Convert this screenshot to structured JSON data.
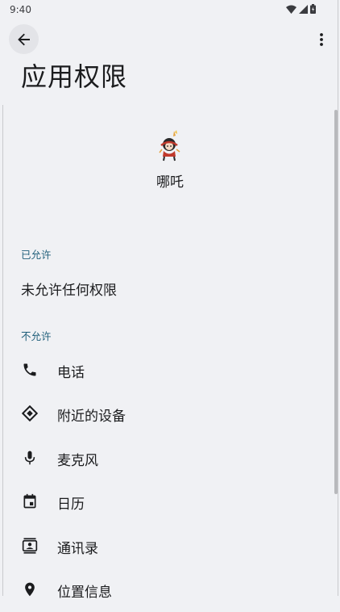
{
  "status": {
    "time": "9:40"
  },
  "page": {
    "title": "应用权限"
  },
  "app": {
    "name": "哪吒",
    "icon": "app-icon-nezha"
  },
  "allowed": {
    "label": "已允许",
    "empty_text": "未允许任何权限"
  },
  "denied": {
    "label": "不允许",
    "items": [
      {
        "label": "电话",
        "icon": "phone-icon"
      },
      {
        "label": "附近的设备",
        "icon": "nearby-devices-icon"
      },
      {
        "label": "麦克风",
        "icon": "microphone-icon"
      },
      {
        "label": "日历",
        "icon": "calendar-icon"
      },
      {
        "label": "通讯录",
        "icon": "contacts-icon"
      },
      {
        "label": "位置信息",
        "icon": "location-icon"
      }
    ]
  },
  "colors": {
    "background": "#f0f1f4",
    "section_label": "#1f5e7a",
    "text": "#1b1c1e"
  }
}
